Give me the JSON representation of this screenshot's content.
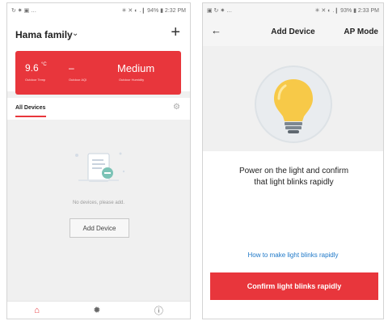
{
  "screen1": {
    "status": {
      "left": "↻ ✷ ▣ …",
      "right": "✳ ✕ ◐ .❙ 94% ▮ 2:32 PM"
    },
    "family_title": "Hama family",
    "weather": {
      "temp_value": "9.6",
      "temp_unit": "°C",
      "temp_label": "Outdoor Temp",
      "aqi_value": "–",
      "aqi_label": "Outdoor AQI",
      "humidity_value": "Medium",
      "humidity_label": "Outdoor Humidity"
    },
    "tab_all_devices": "All Devices",
    "empty_text": "No devices, please add.",
    "add_device_button": "Add Device",
    "bottom_nav": {
      "home": "⌂",
      "scene": "✹",
      "me": "ⓘ"
    }
  },
  "screen2": {
    "status": {
      "left": "▣ ↻ ✷ …",
      "right": "✳ ✕ ◐ .❙ 93% ▮ 2:33 PM"
    },
    "title": "Add Device",
    "ap_mode": "AP Mode",
    "instruction_line1": "Power on the light and confirm",
    "instruction_line2": "that light blinks  rapidly",
    "help_link": "How to make light blinks rapidly",
    "confirm_button": "Confirm light blinks rapidly"
  },
  "colors": {
    "accent": "#e8363c",
    "link": "#1e78c8",
    "bulb": "#f7c948"
  }
}
